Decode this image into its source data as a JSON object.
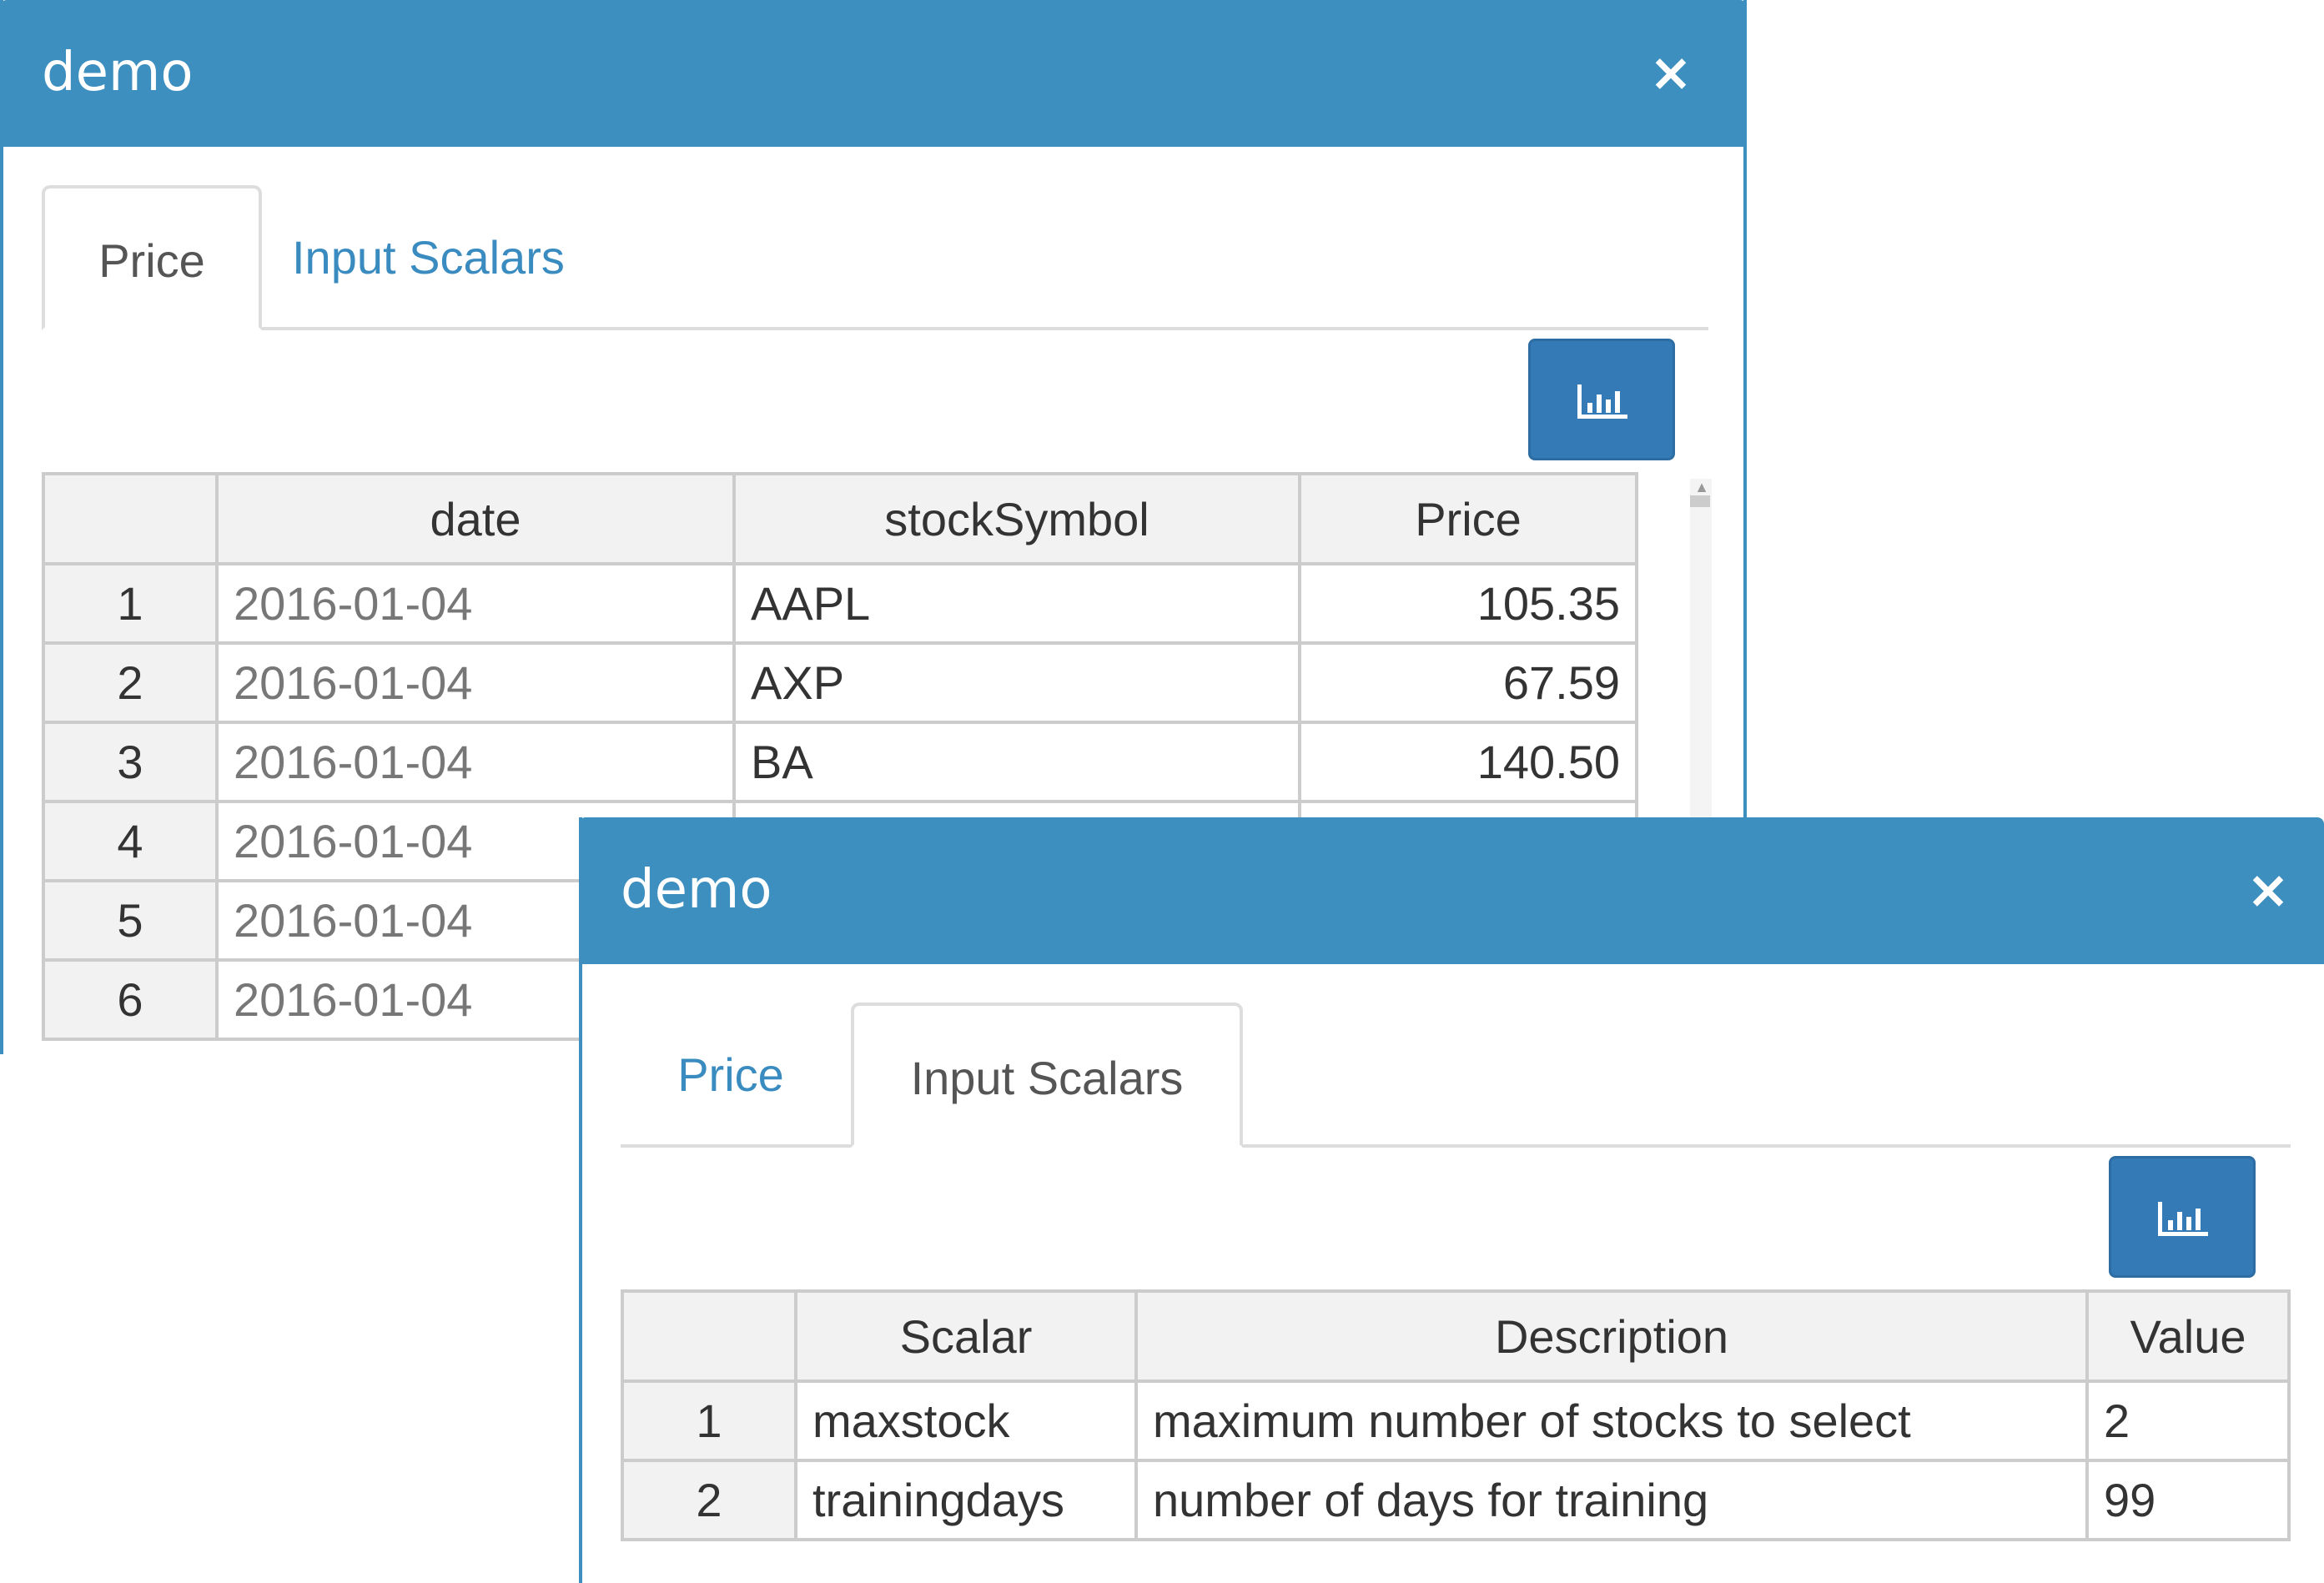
{
  "back_dialog": {
    "title": "demo",
    "close_label": "×",
    "tabs": [
      {
        "label": "Price"
      },
      {
        "label": "Input Scalars"
      }
    ],
    "table": {
      "columns": [
        "",
        "date",
        "stockSymbol",
        "Price"
      ],
      "rows": [
        {
          "n": "1",
          "date": "2016-01-04",
          "symbol": "AAPL",
          "price": "105.35"
        },
        {
          "n": "2",
          "date": "2016-01-04",
          "symbol": "AXP",
          "price": "67.59"
        },
        {
          "n": "3",
          "date": "2016-01-04",
          "symbol": "BA",
          "price": "140.50"
        },
        {
          "n": "4",
          "date": "2016-01-04",
          "symbol": "",
          "price": ""
        },
        {
          "n": "5",
          "date": "2016-01-04",
          "symbol": "",
          "price": ""
        },
        {
          "n": "6",
          "date": "2016-01-04",
          "symbol": "",
          "price": ""
        }
      ]
    }
  },
  "front_dialog": {
    "title": "demo",
    "close_label": "×",
    "tabs": [
      {
        "label": "Price"
      },
      {
        "label": "Input Scalars"
      }
    ],
    "table": {
      "columns": [
        "",
        "Scalar",
        "Description",
        "Value"
      ],
      "rows": [
        {
          "n": "1",
          "scalar": "maxstock",
          "description": "maximum number of stocks to select",
          "value": "2"
        },
        {
          "n": "2",
          "scalar": "trainingdays",
          "description": "number of days for training",
          "value": "99"
        }
      ]
    }
  },
  "icons": {
    "chart_button": "bar-chart-icon",
    "close": "close-icon"
  },
  "colors": {
    "titlebar": "#3d8fbf",
    "button": "#337ab7",
    "link": "#3a8cc0"
  }
}
